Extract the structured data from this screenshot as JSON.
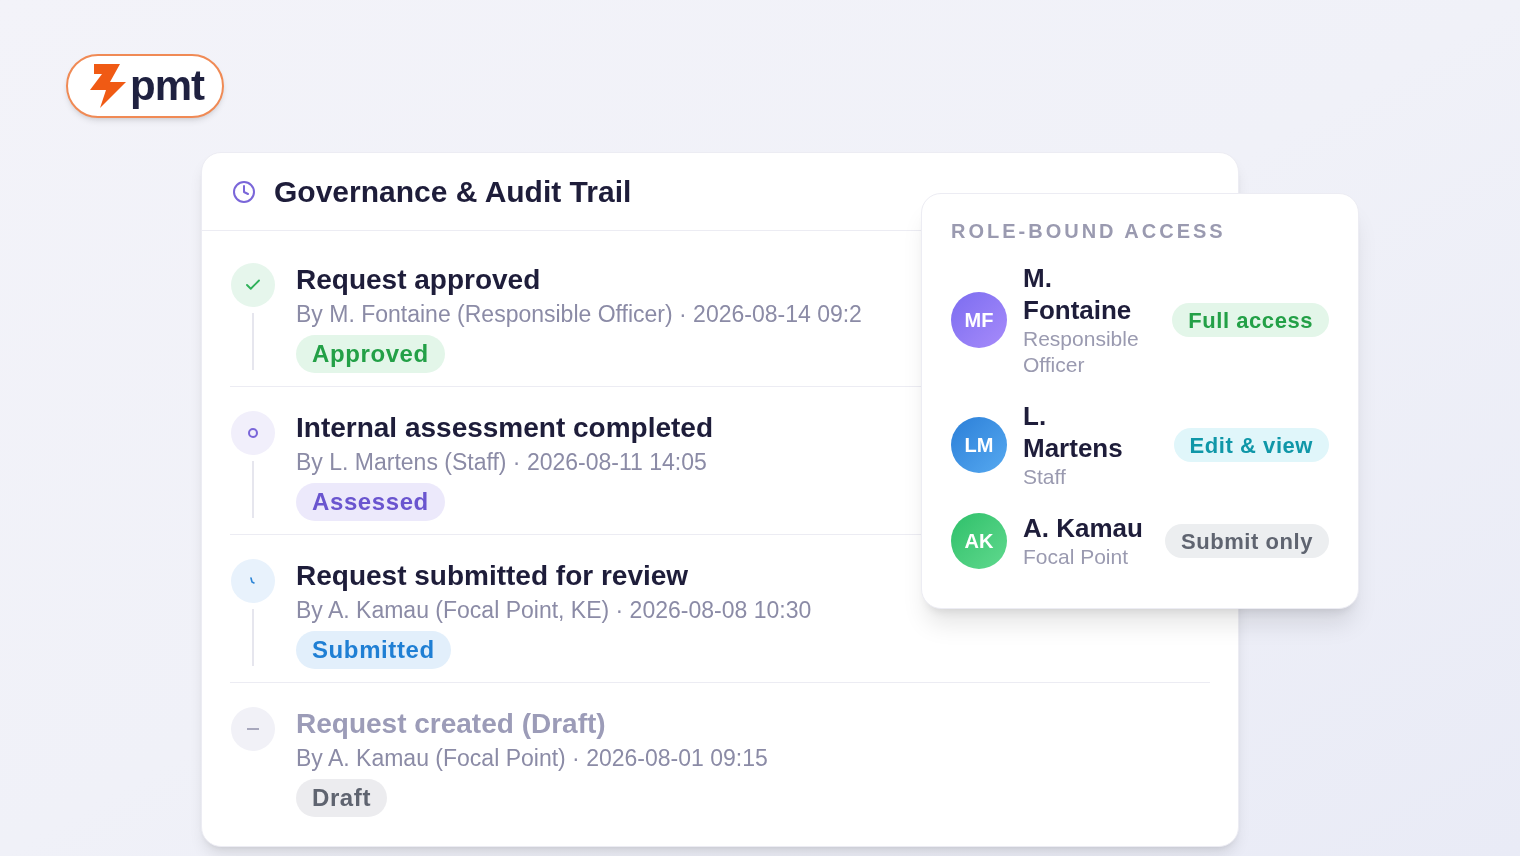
{
  "logo": {
    "text": "pmt"
  },
  "audit": {
    "title": "Governance & Audit Trail",
    "events": [
      {
        "kind": "approved",
        "title": "Request approved",
        "meta": "By M. Fontaine (Responsible Officer) · 2026-08-14 09:2",
        "badge": "Approved"
      },
      {
        "kind": "assessed",
        "title": "Internal assessment completed",
        "meta": "By L. Martens (Staff) · 2026-08-11 14:05",
        "badge": "Assessed"
      },
      {
        "kind": "submitted",
        "title": "Request submitted for review",
        "meta": "By A. Kamau (Focal Point, KE) · 2026-08-08 10:30",
        "badge": "Submitted"
      },
      {
        "kind": "draft",
        "title": "Request created (Draft)",
        "meta": "By A. Kamau (Focal Point) · 2026-08-01 09:15",
        "badge": "Draft"
      }
    ]
  },
  "access": {
    "heading": "ROLE-BOUND ACCESS",
    "people": [
      {
        "initials": "MF",
        "name": "M. Fontaine",
        "role": "Responsible Officer",
        "access": "Full access",
        "kind": "full"
      },
      {
        "initials": "LM",
        "name": "L. Martens",
        "role": "Staff",
        "access": "Edit & view",
        "kind": "edit"
      },
      {
        "initials": "AK",
        "name": "A. Kamau",
        "role": "Focal Point",
        "access": "Submit only",
        "kind": "submit"
      }
    ]
  }
}
